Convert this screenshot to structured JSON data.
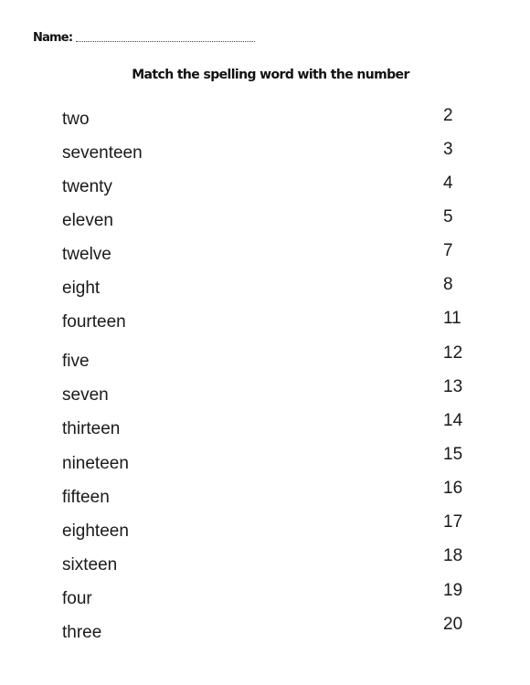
{
  "header": {
    "name_label": "Name:",
    "title": "Match the spelling word with the number"
  },
  "words": [
    "two",
    "seventeen",
    "twenty",
    "eleven",
    "twelve",
    "eight",
    "fourteen",
    "five",
    "seven",
    "thirteen",
    "nineteen",
    "fifteen",
    "eighteen",
    "sixteen",
    "four",
    "three"
  ],
  "numbers": [
    "2",
    "3",
    "4",
    "5",
    "7",
    "8",
    "11",
    "12",
    "13",
    "14",
    "15",
    "16",
    "17",
    "18",
    "19",
    "20"
  ]
}
